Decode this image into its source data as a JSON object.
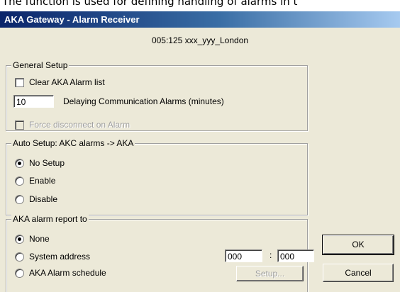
{
  "caption": "The function is used for defining handling of alarms in t",
  "window": {
    "title": "AKA  Gateway - Alarm Receiver"
  },
  "site_label": "005:125  xxx_yyy_London",
  "general_setup": {
    "title": "General Setup",
    "clear_alarm_list_label": "Clear AKA Alarm list",
    "clear_alarm_list_checked": false,
    "delay_value": "10",
    "delay_label": "Delaying Communication Alarms (minutes)",
    "force_disconnect_label": "Force disconnect on Alarm",
    "force_disconnect_checked": false,
    "force_disconnect_enabled": false
  },
  "auto_setup": {
    "title": "Auto Setup: AKC alarms -> AKA",
    "options": [
      "No Setup",
      "Enable",
      "Disable"
    ],
    "selected": "No Setup"
  },
  "report_to": {
    "title": "AKA alarm report to",
    "options": [
      "None",
      "System address",
      "AKA Alarm schedule"
    ],
    "selected": "None",
    "address_part1": "000",
    "address_separator": ":",
    "address_part2": "000",
    "setup_button": "Setup..."
  },
  "buttons": {
    "ok": "OK",
    "cancel": "Cancel"
  }
}
